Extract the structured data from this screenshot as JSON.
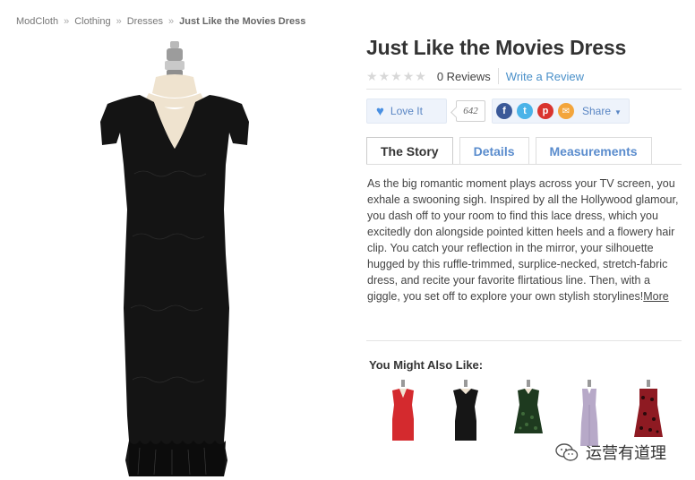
{
  "breadcrumb": {
    "items": [
      "ModCloth",
      "Clothing",
      "Dresses"
    ],
    "separator": "»",
    "current": "Just Like the Movies Dress"
  },
  "product": {
    "title": "Just Like the Movies Dress",
    "rating_stars": 0,
    "reviews_label": "0 Reviews",
    "write_review_label": "Write a Review",
    "image_color": "#111111"
  },
  "social": {
    "love_label": "Love It",
    "love_count": "642",
    "icons": [
      "facebook-icon",
      "twitter-icon",
      "pinterest-icon",
      "email-icon"
    ],
    "share_label": "Share"
  },
  "tabs": [
    {
      "label": "The Story",
      "active": true
    },
    {
      "label": "Details",
      "active": false
    },
    {
      "label": "Measurements",
      "active": false
    }
  ],
  "description": {
    "text": "As the big romantic moment plays across your TV screen, you exhale a swooning sigh. Inspired by all the Hollywood glamour, you dash off to your room to find this lace dress, which you excitedly don alongside pointed kitten heels and a flowery hair clip. You catch your reflection in the mirror, your silhouette hugged by this ruffle-trimmed, surplice-necked, stretch-fabric dress, and recite your favorite flirtatious line. Then, with a giggle, you set off to explore your own stylish storylines!",
    "more_label": "More"
  },
  "also_like": {
    "title": "You Might Also Like:",
    "items": [
      {
        "name": "red-dress",
        "color": "#d42a2e"
      },
      {
        "name": "black-dress",
        "color": "#161616"
      },
      {
        "name": "green-lace-dress",
        "color": "#2c4a2a"
      },
      {
        "name": "lavender-gown",
        "color": "#b7a9c8"
      },
      {
        "name": "red-lace-dress",
        "color": "#8e1a22"
      }
    ]
  },
  "watermark": {
    "text": "运营有道理"
  },
  "colors": {
    "link": "#4a90c9",
    "tab_link": "#5a8ccd",
    "button_bg": "#eef3fb"
  }
}
